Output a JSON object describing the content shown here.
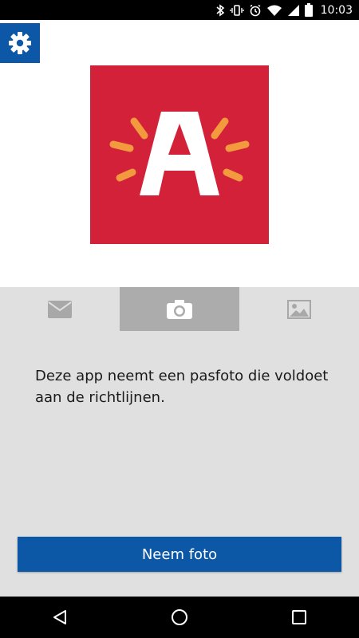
{
  "status_bar": {
    "time": "10:03",
    "icons": [
      "bluetooth-icon",
      "vibrate-icon",
      "alarm-icon",
      "wifi-icon",
      "signal-icon",
      "battery-icon"
    ]
  },
  "header": {
    "settings_icon": "gear-icon",
    "logo_letter": "A",
    "colors": {
      "brand_blue": "#0d57a7",
      "logo_red": "#d22138",
      "logo_rays": "#f39a3f"
    }
  },
  "tabs": [
    {
      "icon": "envelope-icon",
      "active": false
    },
    {
      "icon": "camera-icon",
      "active": true
    },
    {
      "icon": "image-icon",
      "active": false
    }
  ],
  "main": {
    "description": "Deze app neemt een pasfoto die voldoet aan de richtlijnen.",
    "action_label": "Neem foto"
  },
  "nav_bar": {
    "icons": [
      "back-icon",
      "home-icon",
      "recents-icon"
    ]
  }
}
